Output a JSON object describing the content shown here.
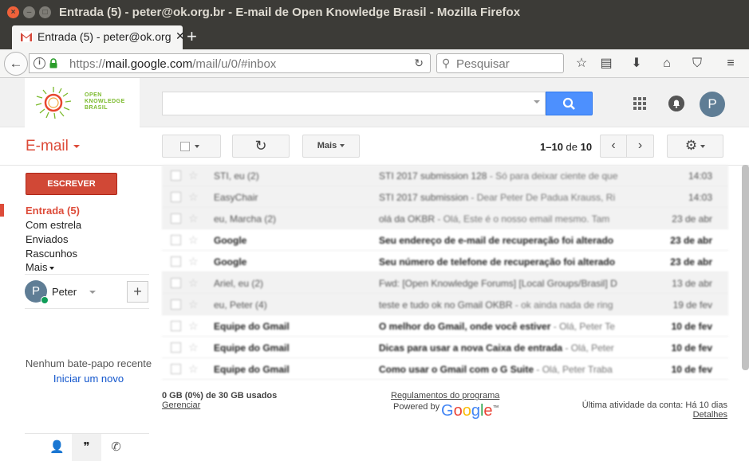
{
  "window": {
    "title": "Entrada (5) - peter@ok.org.br - E-mail de Open Knowledge Brasil - Mozilla Firefox"
  },
  "browser": {
    "tab_title": "Entrada (5) - peter@ok.org.br",
    "url_host": "mail.google.com",
    "url_prefix": "https://",
    "url_path": "/mail/u/0/#inbox",
    "search_placeholder": "Pesquisar"
  },
  "header": {
    "logo_line1": "OPEN",
    "logo_line2": "KNOWLEDGE",
    "logo_line3": "BRASIL",
    "avatar_letter": "P"
  },
  "toolbar": {
    "email_label": "E-mail",
    "more_label": "Mais",
    "page_range": "1–10",
    "page_of": "de",
    "page_total": "10"
  },
  "sidebar": {
    "compose": "ESCREVER",
    "items": [
      {
        "label": "Entrada (5)"
      },
      {
        "label": "Com estrela"
      },
      {
        "label": "Enviados"
      },
      {
        "label": "Rascunhos"
      },
      {
        "label": "Mais"
      }
    ],
    "hangouts": {
      "user": "Peter",
      "avatar_letter": "P",
      "add_label": "+",
      "empty_text": "Nenhum bate-papo recente",
      "start_link": "Iniciar um novo"
    }
  },
  "messages": [
    {
      "from": "STI, eu (2)",
      "subject": "STI 2017 submission 128",
      "snippet": " - Só para deixar ciente de que",
      "date": "14:03",
      "unread": false
    },
    {
      "from": "EasyChair",
      "subject": "STI 2017 submission",
      "snippet": " - Dear Peter De Padua Krauss, Ri",
      "date": "14:03",
      "unread": false
    },
    {
      "from": "eu, Marcha (2)",
      "subject": "olá da OKBR",
      "snippet": " - Olá, Este é o nosso email mesmo. Tam",
      "date": "23 de abr",
      "unread": false
    },
    {
      "from": "Google",
      "subject": "Seu endereço de e-mail de recuperação foi alterado",
      "snippet": "",
      "date": "23 de abr",
      "unread": true
    },
    {
      "from": "Google",
      "subject": "Seu número de telefone de recuperação foi alterado",
      "snippet": "",
      "date": "23 de abr",
      "unread": true
    },
    {
      "from": "Ariel, eu (2)",
      "subject": "Fwd: [Open Knowledge Forums] [Local Groups/Brasil] D",
      "snippet": "",
      "date": "13 de abr",
      "unread": false
    },
    {
      "from": "eu, Peter (4)",
      "subject": "teste e tudo ok no Gmail OKBR",
      "snippet": " - ok ainda nada de ring",
      "date": "19 de fev",
      "unread": false
    },
    {
      "from": "Equipe do Gmail",
      "subject": "O melhor do Gmail, onde você estiver",
      "snippet": " - Olá, Peter Te",
      "date": "10 de fev",
      "unread": true
    },
    {
      "from": "Equipe do Gmail",
      "subject": "Dicas para usar a nova Caixa de entrada",
      "snippet": " - Olá, Peter",
      "date": "10 de fev",
      "unread": true
    },
    {
      "from": "Equipe do Gmail",
      "subject": "Como usar o Gmail com o G Suite",
      "snippet": " - Olá, Peter Traba",
      "date": "10 de fev",
      "unread": true
    }
  ],
  "footer": {
    "quota": "0 GB (0%) de 30 GB usados",
    "manage": "Gerenciar",
    "policies": "Regulamentos do programa",
    "powered_by": "Powered by",
    "google_letters": [
      "G",
      "o",
      "o",
      "g",
      "l",
      "e"
    ],
    "trademark": "™",
    "last_activity": "Última atividade da conta: Há 10 dias",
    "details": "Detalhes"
  },
  "colors": {
    "gmail_red": "#dd4b39",
    "compose_red": "#d14836",
    "search_blue": "#4d90fe",
    "okbr_green": "#7bba2c"
  }
}
